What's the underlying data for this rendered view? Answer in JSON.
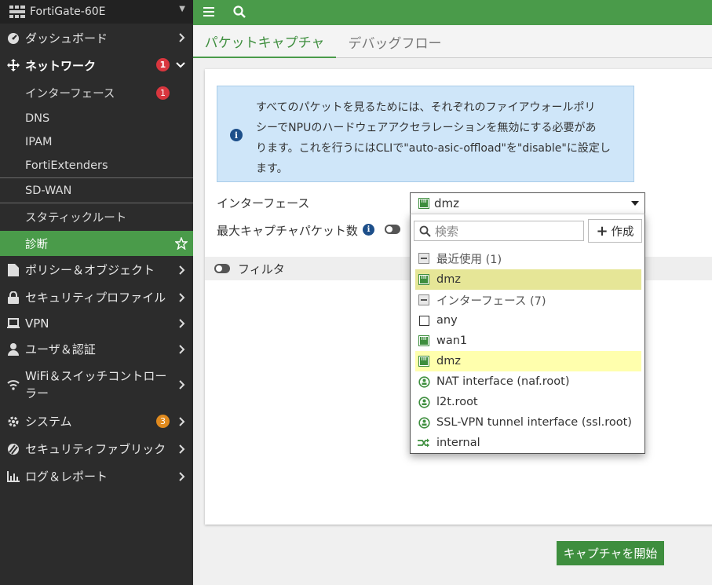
{
  "device": {
    "name": "FortiGate-60E"
  },
  "sidebar": {
    "items": [
      {
        "label": "ダッシュボード"
      },
      {
        "label": "ネットワーク",
        "badge": "1"
      },
      {
        "label": "インターフェース",
        "badge": "1"
      },
      {
        "label": "DNS"
      },
      {
        "label": "IPAM"
      },
      {
        "label": "FortiExtenders"
      },
      {
        "label": "SD-WAN"
      },
      {
        "label": "スタティックルート"
      },
      {
        "label": "診断"
      },
      {
        "label": "ポリシー＆オブジェクト"
      },
      {
        "label": "セキュリティプロファイル"
      },
      {
        "label": "VPN"
      },
      {
        "label": "ユーザ＆認証"
      },
      {
        "label": "WiFi＆スイッチコントロー"
      },
      {
        "label": "ラー"
      },
      {
        "label": "システム",
        "badge": "3"
      },
      {
        "label": "セキュリティファブリック"
      },
      {
        "label": "ログ＆レポート"
      }
    ]
  },
  "tabs": [
    {
      "label": "パケットキャプチャ"
    },
    {
      "label": "デバッグフロー"
    }
  ],
  "info": {
    "lines": [
      "すべてのパケットを見るためには、それぞれのファイアウォールポリ",
      "シーでNPUのハードウェアアクセラレーションを無効にする必要があ",
      "ります。これを行うにはCLIで\"auto-asic-offload\"を\"disable\"に設定し",
      "ます。"
    ]
  },
  "form": {
    "interface_label": "インターフェース",
    "max_packets_label": "最大キャプチャパケット数",
    "filter_label": "フィルタ",
    "start_button": "キャプチャを開始"
  },
  "dropdown": {
    "selected": "dmz",
    "search_placeholder": "検索",
    "create_label": "作成",
    "groups": [
      {
        "label": "最近使用 (1)"
      },
      {
        "label": "インターフェース (7)"
      }
    ],
    "recent": [
      {
        "label": "dmz"
      }
    ],
    "interfaces": [
      {
        "label": "any"
      },
      {
        "label": "wan1"
      },
      {
        "label": "dmz"
      },
      {
        "label": "NAT interface (naf.root)"
      },
      {
        "label": "l2t.root"
      },
      {
        "label": "SSL-VPN tunnel interface (ssl.root)"
      },
      {
        "label": "internal"
      }
    ]
  },
  "colors": {
    "accent_green": "#4a9b4a",
    "sidebar_bg": "#2c2c2c",
    "badge_red": "#d9363e",
    "badge_orange": "#e08a1e",
    "info_bg": "#cfe6f9",
    "highlight_recent": "#e6e697",
    "highlight_current": "#ffffad"
  }
}
